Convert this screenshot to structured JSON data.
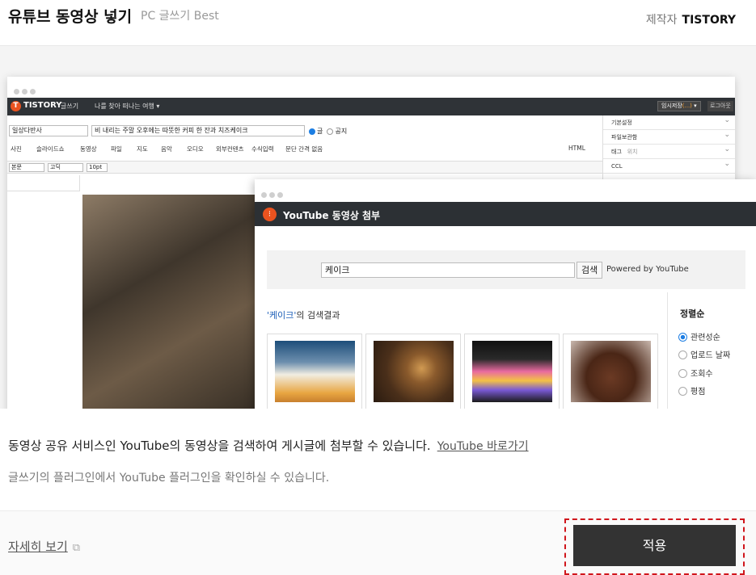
{
  "header": {
    "title": "유튜브 동영상 넣기",
    "subtitle": "PC 글쓰기 Best",
    "maker_label": "제작자",
    "maker_name": "TISTORY"
  },
  "preview": {
    "editor": {
      "logo_text": "TISTORY",
      "mode": "글쓰기",
      "blog_menu": "나를 찾아 떠나는 여행",
      "save_label": "임시저장",
      "save_count": "(...)",
      "logout": "로그아웃",
      "category": "일상다반사",
      "post_title": "비 내리는 주말 오후에는 따뜻한 커피 한 잔과 치즈케이크",
      "visibility": [
        "글",
        "공지"
      ],
      "attach_tools": [
        "사진",
        "슬라이드쇼",
        "동영상",
        "파일",
        "지도",
        "음악",
        "오디오",
        "외부컨텐츠",
        "수식입력"
      ],
      "paragraph_option": "문단 간격 없음",
      "html_label": "HTML",
      "format": {
        "style": "본문",
        "font": "고딕",
        "size": "10pt"
      },
      "sidebar": [
        "기본설정",
        "파일보관함",
        "태그",
        "CCL"
      ],
      "tag_placeholder": "위치"
    },
    "modal": {
      "title": "YouTube 동영상 첨부",
      "search_value": "케이크",
      "search_button": "검색",
      "powered_by": "Powered by YouTube",
      "result_query": "'케이크'",
      "result_suffix": "의 검색결과",
      "sort_title": "정렬순",
      "sort_options": [
        "관련성순",
        "업로드 날짜",
        "조회수",
        "평점"
      ],
      "selected_sort": "관련성순"
    }
  },
  "description": {
    "line1": "동영상 공유 서비스인 YouTube의 동영상을 검색하여 게시글에 첨부할 수 있습니다.",
    "link": "YouTube 바로가기",
    "line2": "글쓰기의 플러그인에서 YouTube 플러그인을 확인하실 수 있습니다."
  },
  "footer": {
    "more_label": "자세히 보기",
    "apply_label": "적용"
  },
  "colors": {
    "accent_orange": "#eb531f",
    "apply_bg": "#333333",
    "highlight_red": "#d0161c",
    "link_blue": "#1d5fb8"
  }
}
